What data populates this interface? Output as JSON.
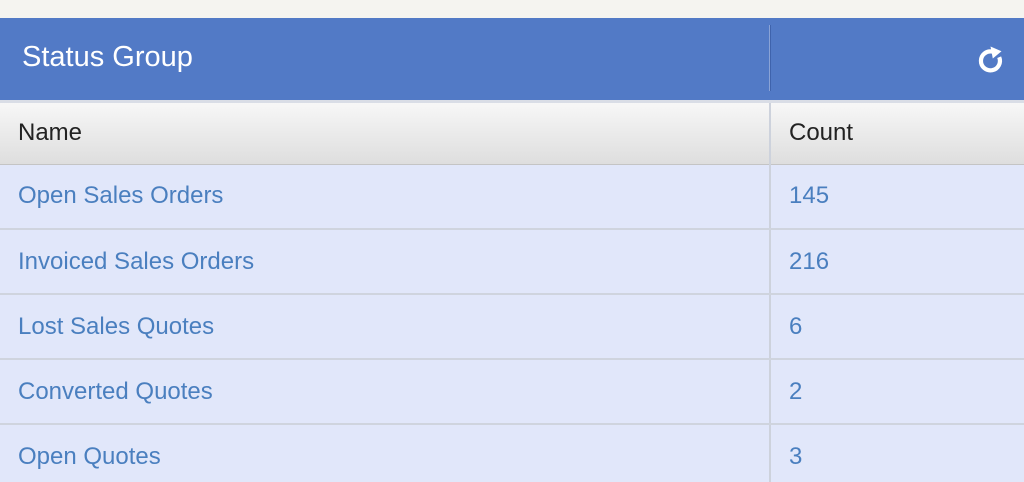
{
  "panel": {
    "title": "Status Group",
    "refresh_icon": "refresh-icon"
  },
  "table": {
    "columns": [
      "Name",
      "Count"
    ],
    "rows": [
      {
        "name": "Open Sales Orders",
        "count": "145"
      },
      {
        "name": "Invoiced Sales Orders",
        "count": "216"
      },
      {
        "name": "Lost Sales Quotes",
        "count": "6"
      },
      {
        "name": "Converted Quotes",
        "count": "2"
      },
      {
        "name": "Open Quotes",
        "count": "3"
      }
    ]
  },
  "colors": {
    "header_bg": "#527ac6",
    "row_bg": "#e1e7fa",
    "link_text": "#4a7fbf"
  }
}
